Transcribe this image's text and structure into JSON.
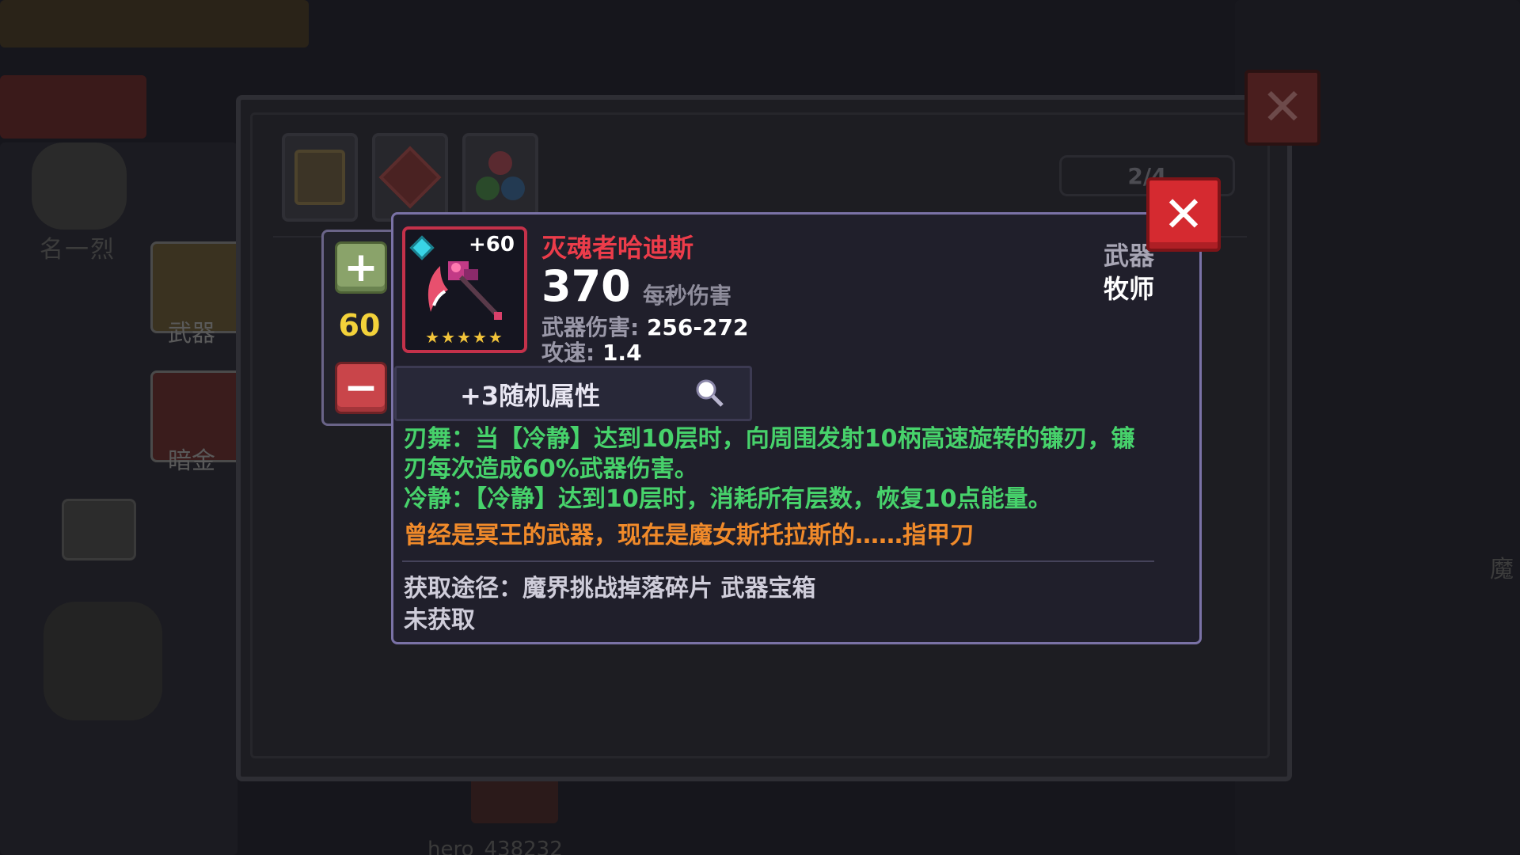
{
  "background": {
    "side_tabs": [
      "武器",
      "暗金"
    ],
    "player_name": "hero_438232",
    "left_text": "名一烈",
    "right_text": "魔"
  },
  "dialog": {
    "page_indicator": "2/4",
    "tabs": [
      "armor-icon",
      "gem-icon",
      "orbs-icon"
    ]
  },
  "stepper": {
    "level": "60",
    "plus_icon": "plus-icon",
    "minus_icon": "minus-icon"
  },
  "item": {
    "name": "灭魂者哈迪斯",
    "enhance_level": "+60",
    "stars": "★★★★★",
    "dps_value": "370",
    "dps_label": "每秒伤害",
    "damage_label": "武器伤害:",
    "damage_value": "256-272",
    "speed_label": "攻速:",
    "speed_value": "1.4",
    "type": "武器",
    "class": "牧师",
    "random_attr": "+3随机属性",
    "skill_desc": "刃舞：当【冷静】达到10层时，向周围发射10柄高速旋转的镰刃，镰刃每次造成60%武器伤害。",
    "calm_desc": "冷静：【冷静】达到10层时，消耗所有层数，恢复10点能量。",
    "lore": "曾经是冥王的武器，现在是魔女斯托拉斯的……指甲刀",
    "source": "获取途径：魔界挑战掉落碎片 武器宝箱",
    "status": "未获取"
  },
  "colors": {
    "item_name": "#ec3c4a",
    "skill_text": "#47d26b",
    "lore_text": "#f08a2a",
    "level_text": "#f3d23a",
    "close_button": "#d52a30",
    "card_border": "#7a72a6"
  }
}
